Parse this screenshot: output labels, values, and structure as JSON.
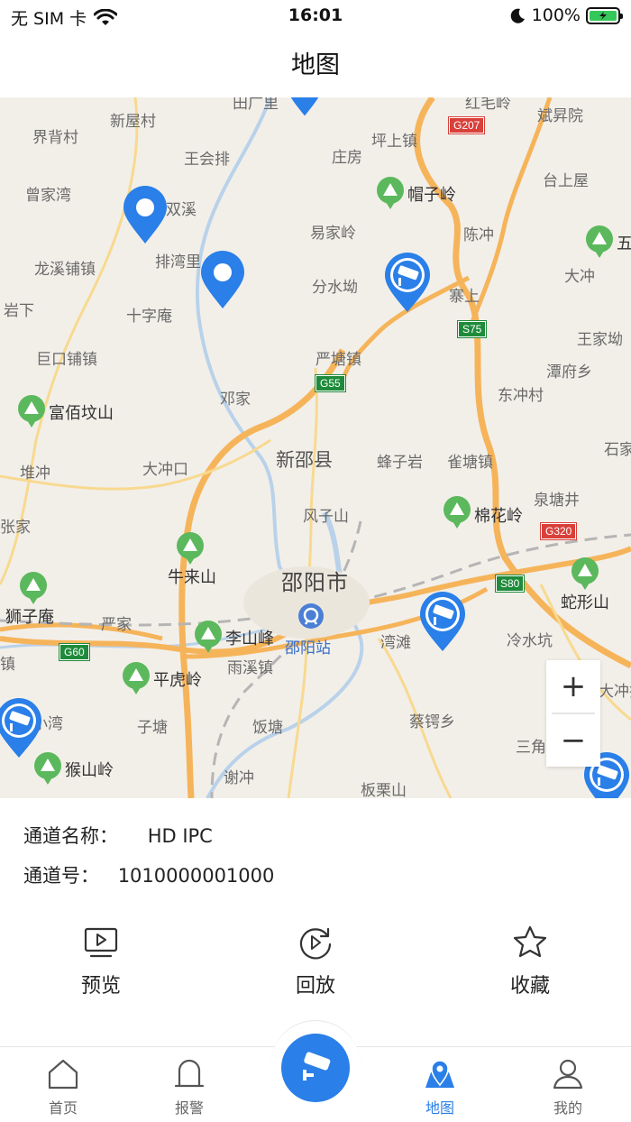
{
  "status_bar": {
    "carrier": "无 SIM 卡",
    "time": "16:01",
    "battery_percent": "100%"
  },
  "header": {
    "title": "地图"
  },
  "map": {
    "city_label": "邵阳市",
    "county_label": "新邵县",
    "station_label": "邵阳站",
    "labels": [
      "新屋村",
      "界背村",
      "王会排",
      "庄房",
      "坪上镇",
      "斌昇院",
      "曾家湾",
      "双溪",
      "易家岭",
      "陈冲",
      "台上屋",
      "龙溪铺镇",
      "排湾里",
      "分水坳",
      "寨上",
      "大冲",
      "岩下",
      "十字庵",
      "王家坳",
      "巨口铺镇",
      "严塘镇",
      "潭府乡",
      "邓家",
      "东冲村",
      "堆冲",
      "大冲口",
      "蜂子岩",
      "雀塘镇",
      "石家",
      "泉塘井",
      "张家",
      "风子山",
      "牛来山",
      "严家",
      "湾滩",
      "冷水坑",
      "镇",
      "雨溪镇",
      "大冲排",
      "小湾",
      "子塘",
      "饭塘",
      "蔡锷乡",
      "三角",
      "谢冲",
      "板栗山",
      "红毛岭",
      "田广里"
    ],
    "peaks": [
      "帽子岭",
      "五",
      "富佰坟山",
      "棉花岭",
      "蛇形山",
      "狮子庵",
      "李山峰",
      "平虎岭",
      "猴山岭"
    ],
    "road_shields": [
      "G207",
      "S75",
      "G55",
      "G320",
      "S80",
      "G60"
    ],
    "zoom_in_label": "+",
    "zoom_out_label": "−"
  },
  "channel": {
    "name_label": "通道名称：",
    "name_value": "HD IPC",
    "number_label": "通道号：",
    "number_value": "1010000001000"
  },
  "actions": [
    {
      "label": "预览",
      "icon": "play-screen-icon"
    },
    {
      "label": "回放",
      "icon": "replay-icon"
    },
    {
      "label": "收藏",
      "icon": "star-icon"
    }
  ],
  "tabs": [
    {
      "label": "首页",
      "icon": "home-icon"
    },
    {
      "label": "报警",
      "icon": "alarm-icon"
    },
    {
      "label": "",
      "icon": "camera-icon"
    },
    {
      "label": "地图",
      "icon": "map-pin-icon"
    },
    {
      "label": "我的",
      "icon": "user-icon"
    }
  ],
  "colors": {
    "accent": "#2a7fe8",
    "map_bg": "#f2efe9",
    "highway": "#f6b45a",
    "peak_green": "#5cb85c"
  }
}
